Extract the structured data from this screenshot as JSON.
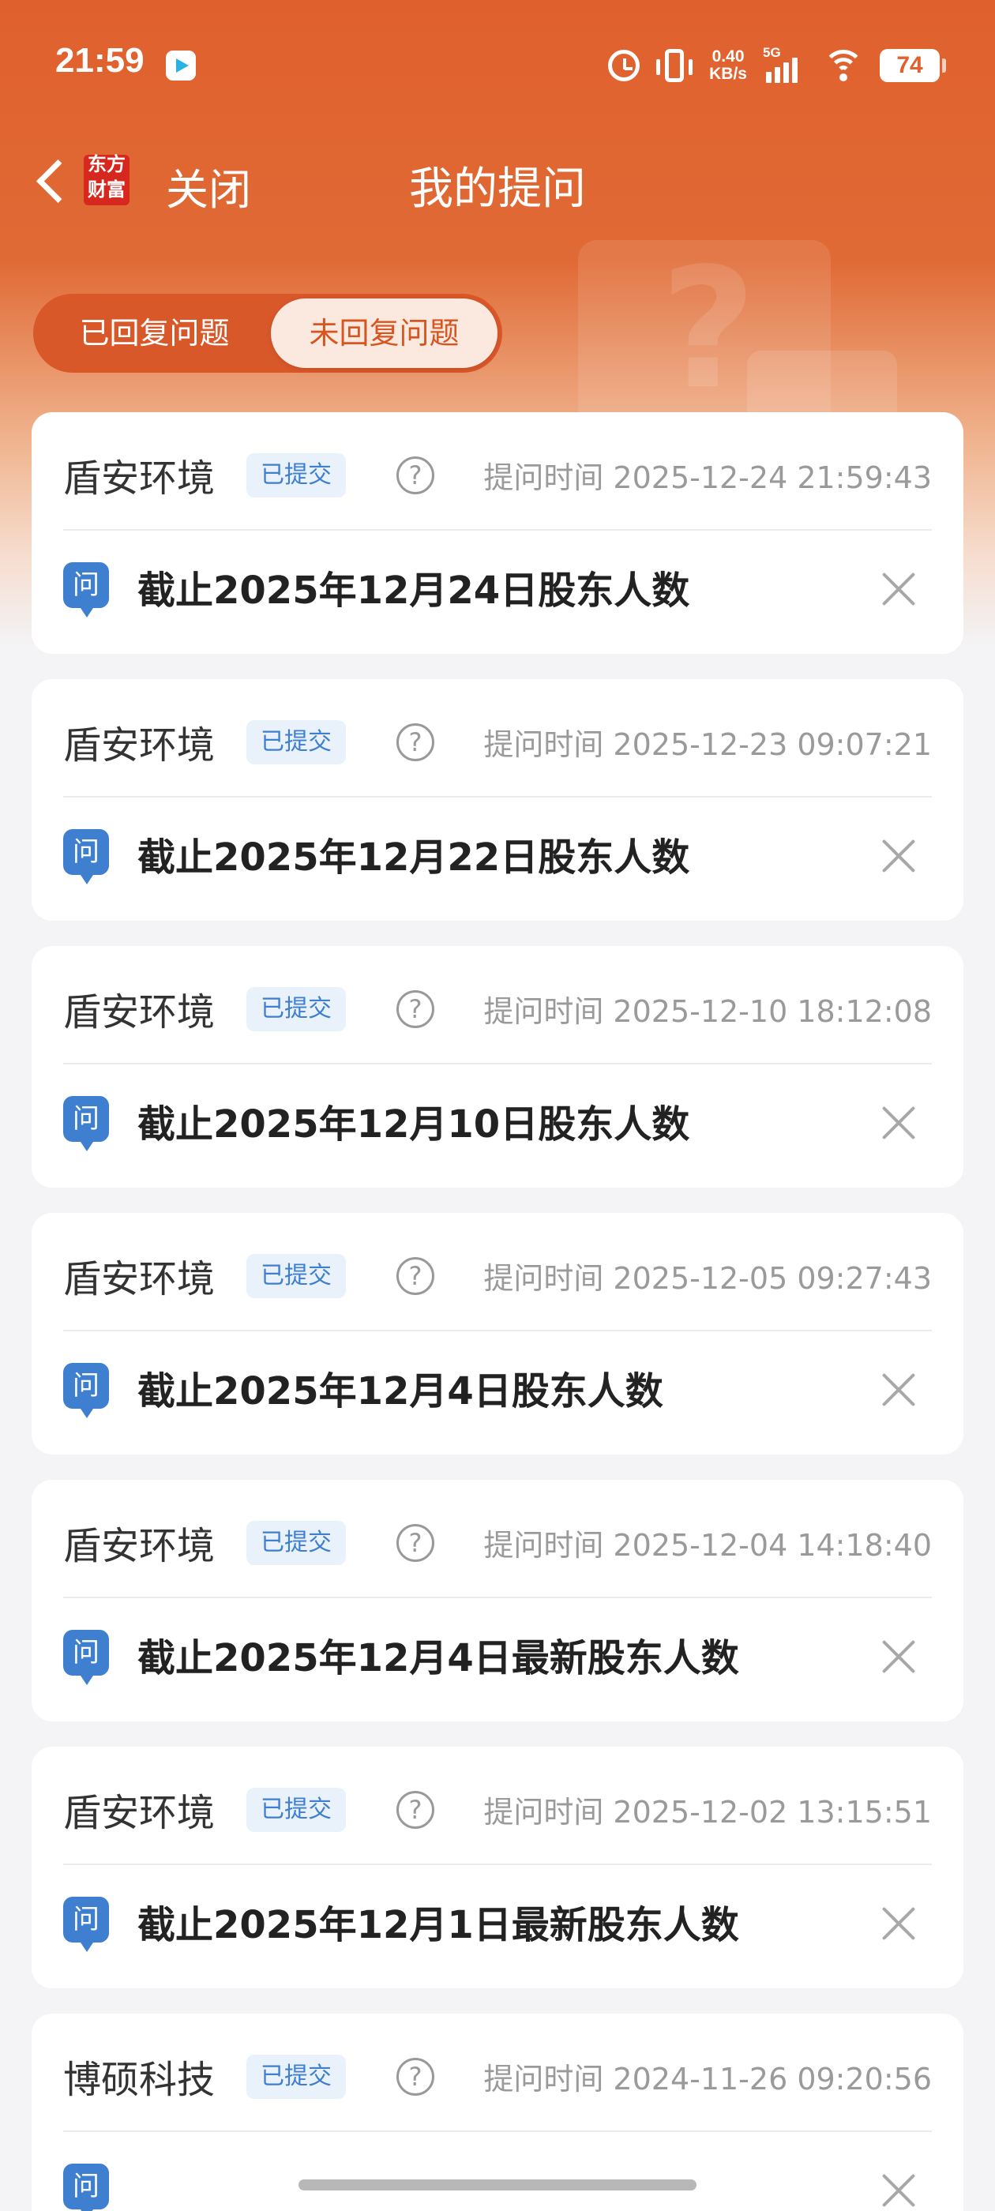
{
  "status_bar": {
    "time": "21:59",
    "net_speed_value": "0.40",
    "net_speed_unit": "KB/s",
    "network_type": "5G",
    "battery": "74",
    "icons": [
      "alarm-icon",
      "vibrate-icon",
      "signal-icon",
      "wifi-icon",
      "battery-icon"
    ]
  },
  "nav": {
    "logo_line1": "东方",
    "logo_line2": "财富",
    "close_label": "关闭",
    "title": "我的提问"
  },
  "tabs": [
    {
      "label": "已回复问题",
      "active": false
    },
    {
      "label": "未回复问题",
      "active": true
    }
  ],
  "colors": {
    "brand_orange": "#e0602d",
    "badge_blue": "#3f7fd0",
    "active_tab_text": "#d8551f"
  },
  "questions": [
    {
      "company": "盾安环境",
      "status": "已提交",
      "time": "提问时间 2025-12-24 21:59:43",
      "question": "截止2025年12月24日股东人数"
    },
    {
      "company": "盾安环境",
      "status": "已提交",
      "time": "提问时间 2025-12-23 09:07:21",
      "question": "截止2025年12月22日股东人数"
    },
    {
      "company": "盾安环境",
      "status": "已提交",
      "time": "提问时间 2025-12-10 18:12:08",
      "question": "截止2025年12月10日股东人数"
    },
    {
      "company": "盾安环境",
      "status": "已提交",
      "time": "提问时间 2025-12-05 09:27:43",
      "question": "截止2025年12月4日股东人数"
    },
    {
      "company": "盾安环境",
      "status": "已提交",
      "time": "提问时间 2025-12-04 14:18:40",
      "question": "截止2025年12月4日最新股东人数"
    },
    {
      "company": "盾安环境",
      "status": "已提交",
      "time": "提问时间 2025-12-02 13:15:51",
      "question": "截止2025年12月1日最新股东人数"
    },
    {
      "company": "博硕科技",
      "status": "已提交",
      "time": "提问时间 2024-11-26 09:20:56",
      "question": ""
    }
  ],
  "help_glyph": "?",
  "question_glyph": "问"
}
